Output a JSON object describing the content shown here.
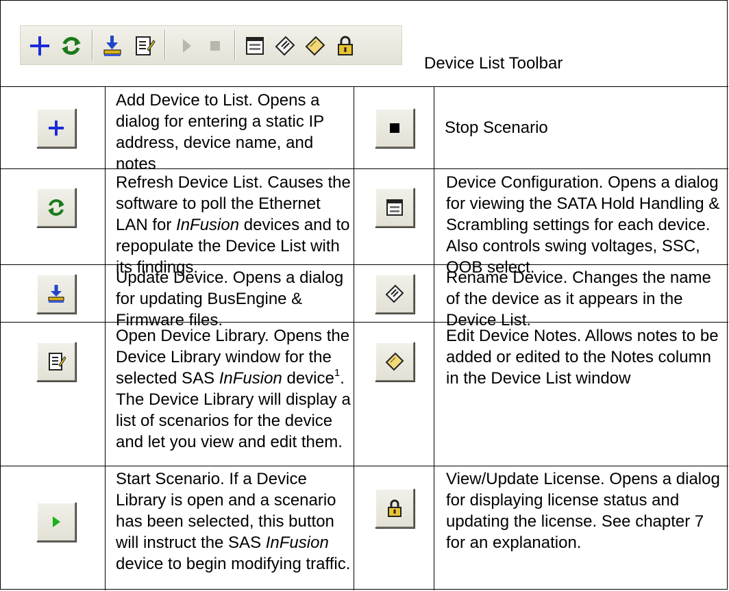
{
  "toolbar": {
    "caption": "Device List Toolbar",
    "icons": [
      "plus-icon",
      "refresh-icon",
      "update-icon",
      "library-icon",
      "play-icon",
      "stop-icon",
      "config-icon",
      "rename-icon",
      "notes-icon",
      "lock-icon"
    ]
  },
  "rows": [
    {
      "left": {
        "icon": "plus-icon",
        "text_a": "Add Device to List.  Opens a dialog for entering a static IP address, device name, and notes"
      },
      "right": {
        "icon": "stop-icon",
        "text_a": "Stop Scenario"
      }
    },
    {
      "left": {
        "icon": "refresh-icon",
        "text_a": "Refresh Device List.  Causes the software to poll the Ethernet LAN for ",
        "em": "InFusion",
        "text_b": " devices and to repopulate the Device List with its findings."
      },
      "right": {
        "icon": "config-icon",
        "text_a": "Device Configuration.  Opens a dialog for viewing the SATA Hold Handling & Scrambling  settings for each device.  Also controls swing voltages, SSC, OOB select."
      }
    },
    {
      "left": {
        "icon": "update-icon",
        "text_a": "Update Device.  Opens a dialog for updating BusEngine & Firmware files."
      },
      "right": {
        "icon": "rename-icon",
        "text_a": "Rename Device.  Changes the name of the device as it appears in the Device List."
      }
    },
    {
      "left": {
        "icon": "library-icon",
        "text_a": "Open Device Library.  Opens the Device Library window for the selected SAS ",
        "em": "InFusion",
        "text_b": " device",
        "sup": "1",
        "text_c": ".  The Device Library will display a list of scenarios for the device and let  you view and edit them."
      },
      "right": {
        "icon": "notes-icon",
        "text_a": "Edit Device Notes.  Allows notes to be added or edited to the Notes column in the Device List window"
      }
    },
    {
      "left": {
        "icon": "play-icon",
        "text_a": "Start Scenario.  If a Device Library is open and a scenario has been selected, this button will instruct the SAS ",
        "em": "InFusion",
        "text_b": " device to begin modifying traffic."
      },
      "right": {
        "icon": "lock-icon",
        "text_a": "View/Update License.  Opens a dialog for  displaying license status and updating the license.  See chapter 7 for an explanation."
      }
    }
  ]
}
